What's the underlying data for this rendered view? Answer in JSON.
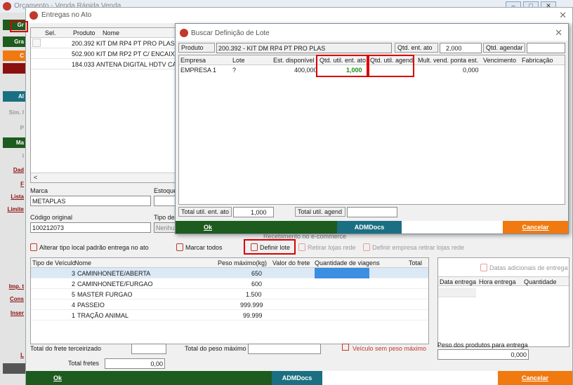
{
  "bg": {
    "title": "Orçamento - Venda Rápida Venda",
    "left_buttons": [
      "Gr",
      "Gra",
      "C",
      "",
      "Al"
    ],
    "left_texts": [
      "Sim. I",
      "P",
      "Ma",
      "I",
      "Dad",
      "F",
      "Lista",
      "Limite",
      "Imp. t",
      "Cons",
      "Inser",
      "L"
    ]
  },
  "entregas": {
    "title": "Entregas no Ato",
    "close": "✕",
    "grid": {
      "headers": [
        "Sel.",
        "Produto",
        "Nome"
      ],
      "rows": [
        {
          "code": "200.392",
          "name": "KIT DM RP4 PT PRO PLAS"
        },
        {
          "code": "502.900",
          "name": "KIT DM RP2 PT C/ ENCAIXE G"
        },
        {
          "code": "184.033",
          "name": "ANTENA DIGITAL HDTV CABO"
        }
      ],
      "scroll_left": "<"
    },
    "marca_label": "Marca",
    "marca_value": "METAPLAS",
    "estoque_label": "Estoque",
    "codigo_label": "Código original",
    "codigo_value": "100212073",
    "tipo_label": "Tipo de",
    "tipo_value": "Nenhum",
    "recebimento": "Recebimento no e-commerce",
    "actions": {
      "alterar": "Alterar tipo local padrão entrega no ato",
      "marcar": "Marcar todos",
      "definir": "Definir lote",
      "retirar": "Retirar lojas rede",
      "definir_empresa": "Definir empresa retirar lojas rede"
    },
    "vehicles": {
      "headers": [
        "Tipo de Veículo",
        "Nome",
        "Peso máximo(kg)",
        "Valor do frete",
        "Quantidade de viagens",
        "Total"
      ],
      "rows": [
        {
          "code": "3",
          "name": "CAMINHONETE/ABERTA",
          "peso": "650"
        },
        {
          "code": "2",
          "name": "CAMINHONETE/FURGAO",
          "peso": "600"
        },
        {
          "code": "5",
          "name": "MASTER FURGAO",
          "peso": "1.500"
        },
        {
          "code": "4",
          "name": "PASSEIO",
          "peso": "999.999"
        },
        {
          "code": "1",
          "name": "TRAÇÃO ANIMAL",
          "peso": "99.999"
        }
      ]
    },
    "side": {
      "datas_btn": "Datas adicionais de entrega",
      "headers": [
        "Data entrega",
        "Hora entrega",
        "Quantidade"
      ]
    },
    "total_frete_terc": "Total do frete terceirizado",
    "total_peso_max": "Total do peso máximo",
    "veiculo_sem_peso": "Veículo sem peso máximo",
    "peso_produtos_label": "Peso dos produtos para entrega",
    "peso_produtos_value": "0,000",
    "total_fretes_label": "Total fretes",
    "total_fretes_value": "0,00",
    "ok": "Ok",
    "adm": "ADMDocs",
    "cancel": "Cancelar"
  },
  "lote": {
    "title": "Buscar Definição de Lote",
    "close": "✕",
    "produto_label": "Produto",
    "produto_value": "200.392 - KIT DM RP4 PT PRO PLAS",
    "qtd_ato_label": "Qtd. ent. ato",
    "qtd_ato_value": "2,000",
    "qtd_agendar_label": "Qtd. agendar",
    "qtd_agendar_value": "",
    "headers": [
      "Empresa",
      "Lote",
      "Est. disponível",
      "Qtd. util. ent. ato",
      "Qtd. util. agend.",
      "Mult. vend. ponta est.",
      "Vencimento",
      "Fabricação"
    ],
    "row": {
      "empresa": "EMPRESA 1",
      "lote": "?",
      "est": "400,000",
      "qtd_ato": "1,000",
      "qtd_agend": "",
      "mult": "0,000"
    },
    "total_ato_label": "Total util. ent. ato",
    "total_ato_value": "1,000",
    "total_agend_label": "Total util. agend",
    "total_agend_value": "",
    "ok": "Ok",
    "adm": "ADMDocs",
    "cancel": "Cancelar"
  }
}
